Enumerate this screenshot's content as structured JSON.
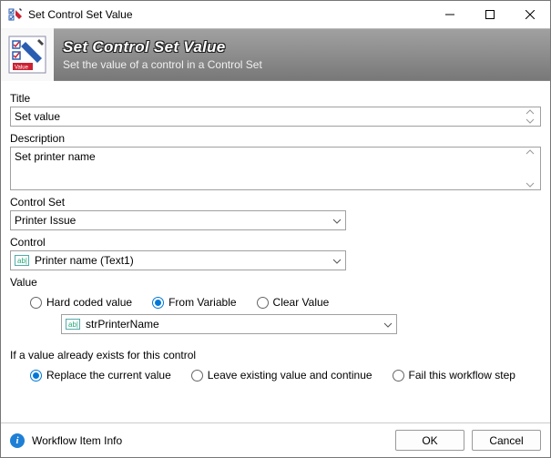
{
  "window": {
    "title": "Set Control Set Value"
  },
  "header": {
    "title": "Set Control Set Value",
    "subtitle": "Set the value of a control in a Control Set"
  },
  "labels": {
    "title": "Title",
    "description": "Description",
    "controlSet": "Control Set",
    "control": "Control",
    "value": "Value",
    "existing": "If a value already exists for this control"
  },
  "fields": {
    "title": "Set value",
    "description": "Set printer name",
    "controlSet": "Printer Issue",
    "control": "Printer name (Text1)",
    "variable": "strPrinterName"
  },
  "valueSource": {
    "options": {
      "hard": "Hard coded value",
      "variable": "From Variable",
      "clear": "Clear Value"
    },
    "selected": "variable"
  },
  "existingBehavior": {
    "options": {
      "replace": "Replace the current value",
      "leave": "Leave existing value and continue",
      "fail": "Fail this workflow step"
    },
    "selected": "replace"
  },
  "footer": {
    "info": "Workflow Item Info",
    "ok": "OK",
    "cancel": "Cancel"
  }
}
